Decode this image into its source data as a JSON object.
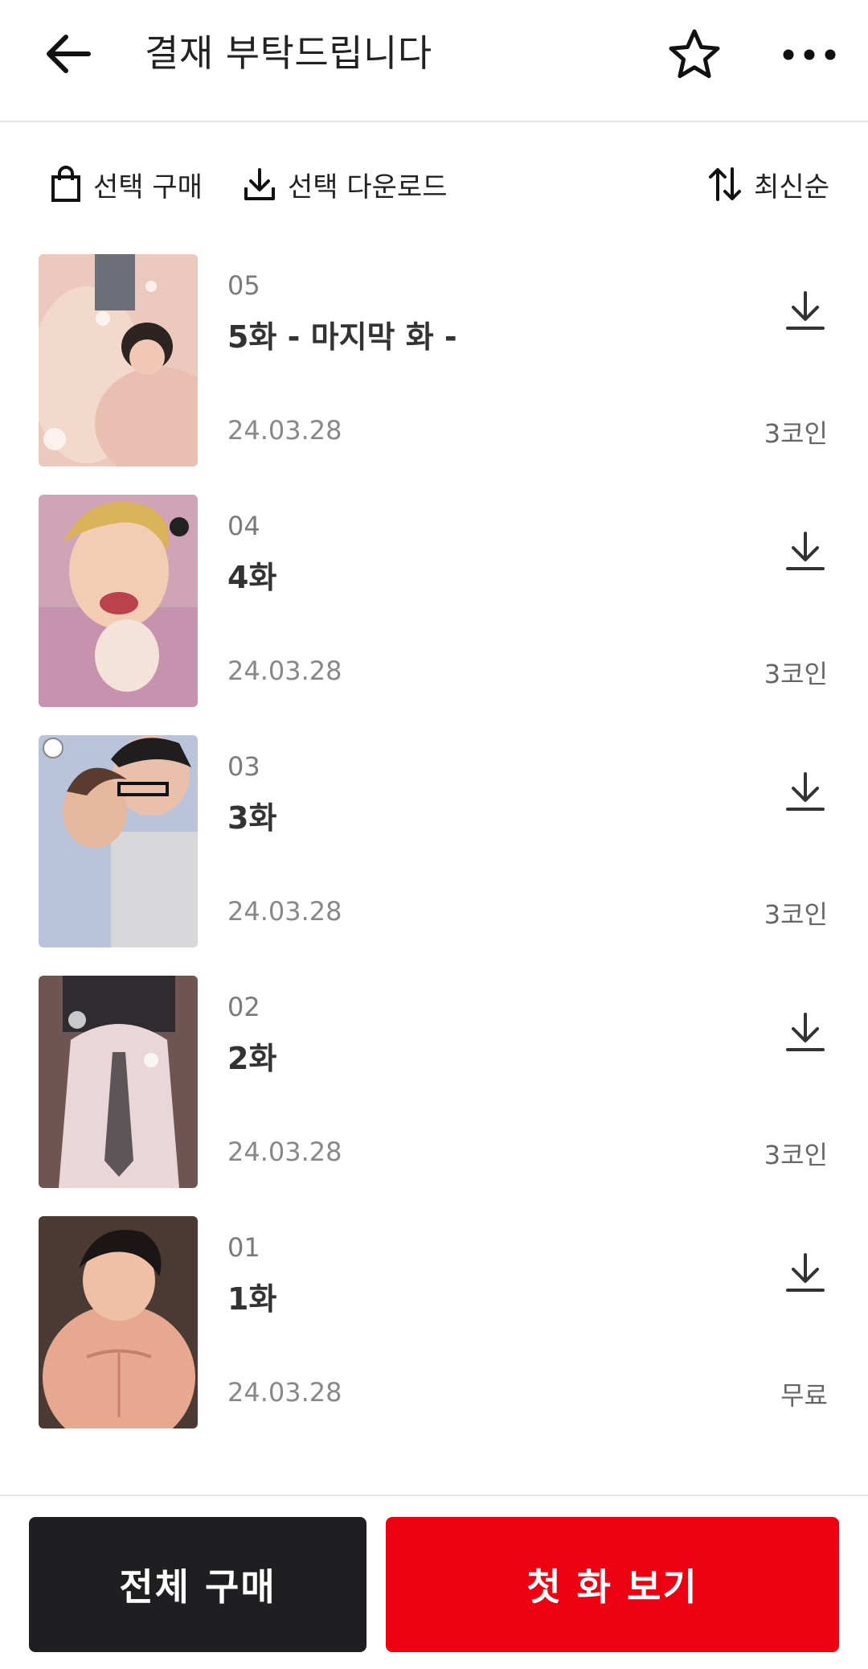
{
  "header": {
    "title": "결재 부탁드립니다",
    "icons": {
      "back": "arrow-left-icon",
      "favorite": "star-icon",
      "more": "more-horizontal-icon"
    }
  },
  "toolbar": {
    "select_buy": "선택 구매",
    "select_download": "선택 다운로드",
    "sort": "최신순",
    "icons": {
      "buy": "shopping-bag-icon",
      "download": "download-icon",
      "sort": "sort-arrows-icon"
    }
  },
  "episodes": [
    {
      "number": "05",
      "title": "5화 - 마지막 화 -",
      "date": "24.03.28",
      "price": "3코인"
    },
    {
      "number": "04",
      "title": "4화",
      "date": "24.03.28",
      "price": "3코인"
    },
    {
      "number": "03",
      "title": "3화",
      "date": "24.03.28",
      "price": "3코인"
    },
    {
      "number": "02",
      "title": "2화",
      "date": "24.03.28",
      "price": "3코인"
    },
    {
      "number": "01",
      "title": "1화",
      "date": "24.03.28",
      "price": "무료"
    }
  ],
  "bottom": {
    "buy_all": "전체 구매",
    "view_first": "첫 화 보기"
  },
  "colors": {
    "accent_red": "#ed0012",
    "dark_button": "#1f1f22",
    "divider": "#e6e6e6"
  }
}
